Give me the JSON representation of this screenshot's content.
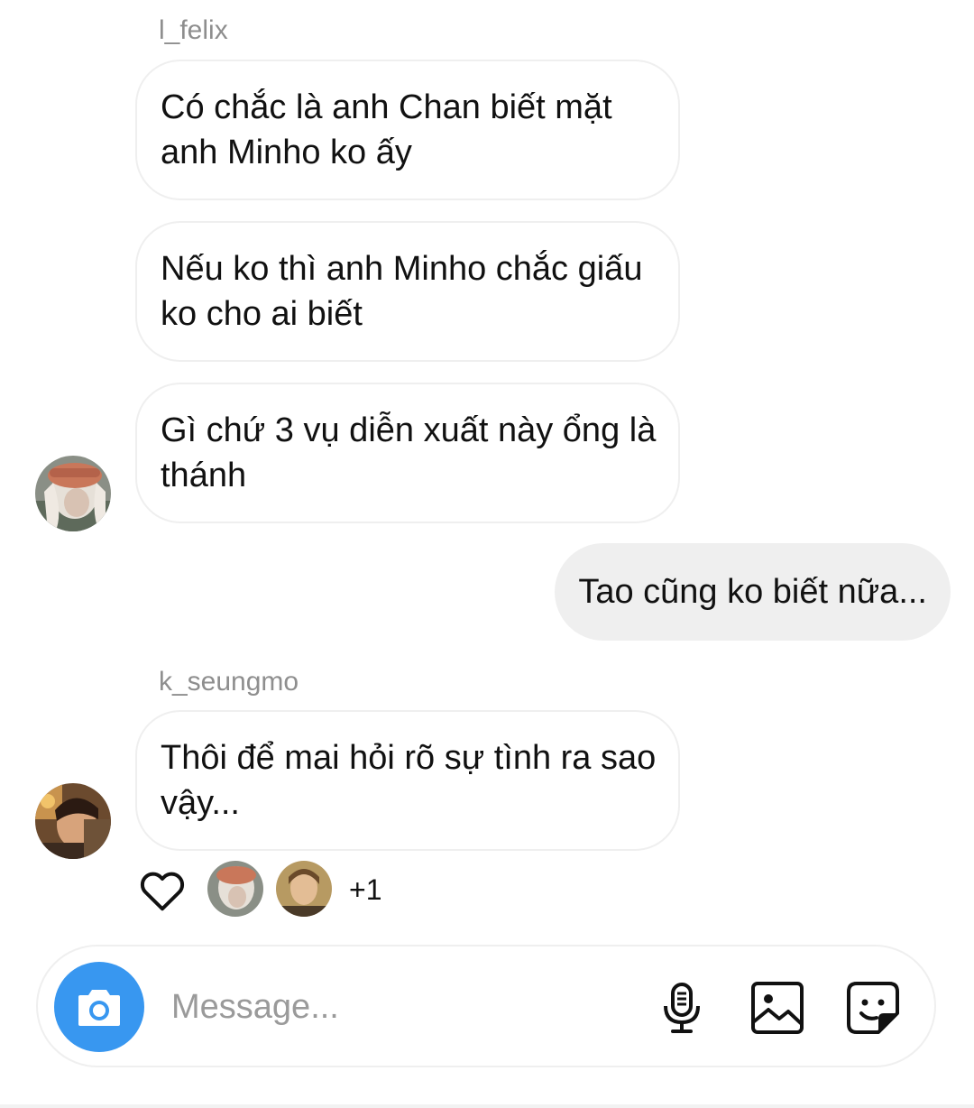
{
  "thread": {
    "messages": [
      {
        "sender": "l_felix",
        "text": "Có chắc là anh Chan biết mặt anh Minho ko ấy"
      },
      {
        "text": "Nếu ko thì anh Minho chắc giấu ko cho ai biết"
      },
      {
        "text": "Gì chứ 3 vụ diễn xuất này ổng là thánh"
      },
      {
        "direction": "outgoing",
        "text": "Tao cũng ko biết nữa..."
      },
      {
        "sender": "k_seungmo",
        "text": "Thôi để mai hỏi rõ sự tình ra sao vậy..."
      }
    ],
    "reactions": {
      "icon": "heart-outline-icon",
      "extra_count": "+1"
    }
  },
  "composer": {
    "placeholder": "Message...",
    "value": "",
    "icons": [
      "camera-icon",
      "microphone-icon",
      "gallery-icon",
      "sticker-icon"
    ]
  },
  "colors": {
    "accent": "#3897f0",
    "outgoing_bubble": "#efefef",
    "incoming_border": "#efefef",
    "username": "#8e8e8e"
  }
}
